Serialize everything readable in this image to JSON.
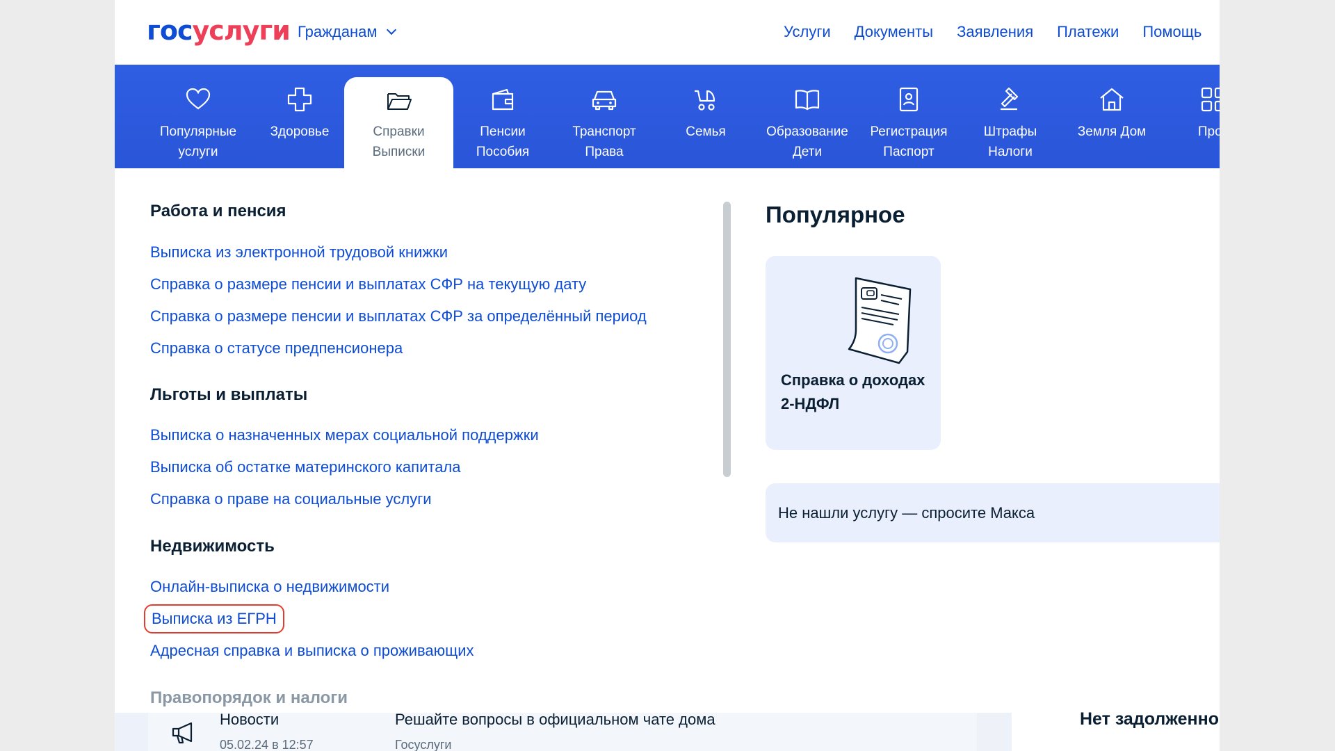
{
  "header": {
    "logo_part1": "гос",
    "logo_part2": "услуги",
    "audience": "Гражданам",
    "nav": [
      "Услуги",
      "Документы",
      "Заявления",
      "Платежи",
      "Помощь"
    ]
  },
  "categories": [
    {
      "icon": "heart-icon",
      "line1": "Популярные",
      "line2": "услуги"
    },
    {
      "icon": "health-cross-icon",
      "line1": "Здоровье",
      "line2": ""
    },
    {
      "icon": "folder-icon",
      "line1": "Справки",
      "line2": "Выписки"
    },
    {
      "icon": "wallet-icon",
      "line1": "Пенсии",
      "line2": "Пособия"
    },
    {
      "icon": "car-icon",
      "line1": "Транспорт",
      "line2": "Права"
    },
    {
      "icon": "stroller-icon",
      "line1": "Семья",
      "line2": ""
    },
    {
      "icon": "book-icon",
      "line1": "Образование",
      "line2": "Дети"
    },
    {
      "icon": "passport-icon",
      "line1": "Регистрация",
      "line2": "Паспорт"
    },
    {
      "icon": "gavel-icon",
      "line1": "Штрафы",
      "line2": "Налоги"
    },
    {
      "icon": "house-icon",
      "line1": "Земля Дом",
      "line2": ""
    },
    {
      "icon": "grid-icon",
      "line1": "Проч",
      "line2": ""
    }
  ],
  "active_category": "Справки Выписки",
  "sections": [
    {
      "title": "Работа и пенсия",
      "links": [
        "Выписка из электронной трудовой книжки",
        "Справка о размере пенсии и выплатах СФР на текущую дату",
        "Справка о размере пенсии и выплатах СФР за определённый период",
        "Справка о статусе предпенсионера"
      ]
    },
    {
      "title": "Льготы и выплаты",
      "links": [
        "Выписка о назначенных мерах социальной поддержки",
        "Выписка об остатке материнского капитала",
        "Справка о праве на социальные услуги"
      ]
    },
    {
      "title": "Недвижимость",
      "links": [
        "Онлайн-выписка о недвижимости",
        "Выписка из ЕГРН",
        "Адресная справка и выписка о проживающих"
      ]
    },
    {
      "title": "Правопорядок и налоги",
      "links": []
    }
  ],
  "highlighted_link": "Выписка из ЕГРН",
  "popular": {
    "title": "Популярное",
    "card_title": "Справка о доходах 2-НДФЛ",
    "card_line1": "Справка о доходах",
    "card_line2": "2-НДФЛ",
    "ask": "Не нашли услугу — спросите Макса"
  },
  "bottom": {
    "news_title": "Новости",
    "news_date": "05.02.24 в 12:57",
    "promo_title": "Решайте вопросы в официальном чате дома",
    "promo_source": "Госуслуги",
    "debt": "Нет задолженно"
  },
  "colors": {
    "brand_blue": "#0d4cd3",
    "brand_red": "#ee3f58",
    "category_bar": "#2e5ae0",
    "highlight": "#e03c2f",
    "card_bg": "#e9effc"
  }
}
